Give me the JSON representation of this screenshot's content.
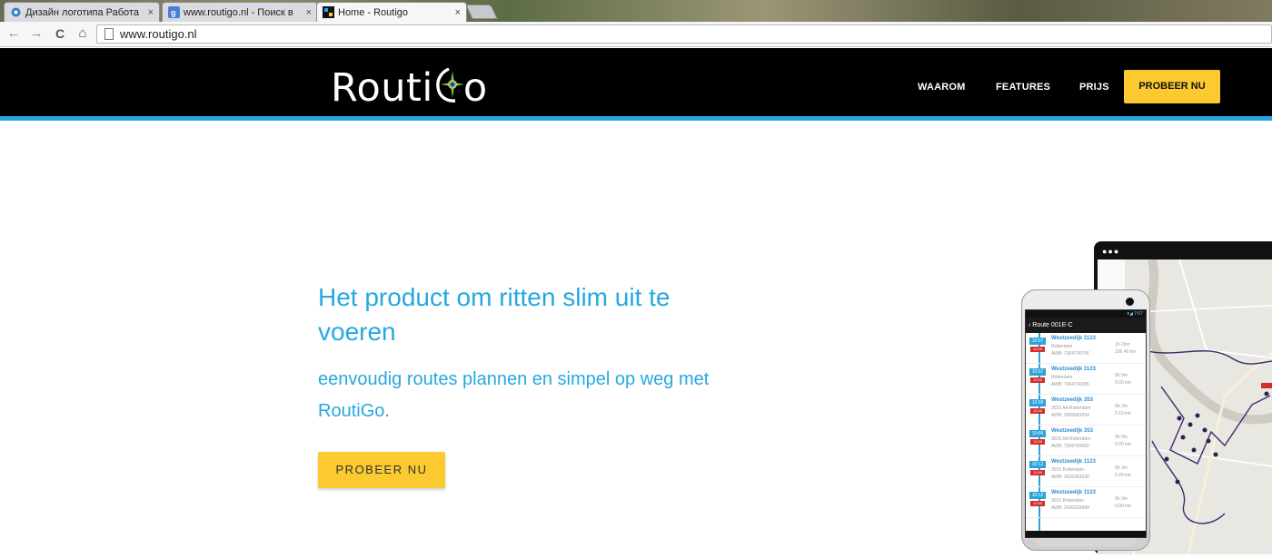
{
  "browser": {
    "tabs": [
      {
        "title": "Дизайн логотипа Работа",
        "active": false,
        "favicon": "gear-icon"
      },
      {
        "title": "www.routigo.nl - Поиск в",
        "active": false,
        "favicon": "google-icon"
      },
      {
        "title": "Home - Routigo",
        "active": true,
        "favicon": "routigo-icon"
      }
    ],
    "close_glyph": "×",
    "nav": {
      "back": "←",
      "forward": "→",
      "reload": "C",
      "home": "⌂"
    },
    "address": "www.routigo.nl"
  },
  "header": {
    "logo_left": "Routi",
    "logo_right": "o",
    "menu": [
      "WAAROM",
      "FEATURES",
      "PRIJS"
    ],
    "cta": "PROBEER NU"
  },
  "hero": {
    "title": "Het product om ritten slim uit te voeren",
    "subtitle": "eenvoudig routes plannen en simpel op weg met RoutiGo.",
    "cta": "PROBEER NU"
  },
  "phone_app": {
    "status": "▾◢ 7:07",
    "title": "‹ Route 001E-C",
    "stops": [
      {
        "time": "10:07",
        "tag": "12:00",
        "street": "Westzeedijk 1123",
        "city": "Rotterdam",
        "awb": "AWB: 7364730796",
        "dur": "1h 20m",
        "dist": "106.40 km"
      },
      {
        "time": "10:07",
        "tag": "12:00",
        "street": "Westzeedijk 1123",
        "city": "Rotterdam",
        "awb": "AWB: 7364730395",
        "dur": "0h 0m",
        "dist": "0.00 km"
      },
      {
        "time": "10:09",
        "tag": "12:00",
        "street": "Westzeedijk 353",
        "city": "3015 AA Rotterdam",
        "awb": "AWB: 2006583654",
        "dur": "0h 2m",
        "dist": "0.10 km"
      },
      {
        "time": "10:09",
        "tag": "12:00",
        "street": "Westzeedijk 353",
        "city": "3015 AA Rotterdam",
        "awb": "AWB: 7268760602",
        "dur": "0h 0m",
        "dist": "0.00 km"
      },
      {
        "time": "10:12",
        "tag": "12:00",
        "street": "Westzeedijk 1123",
        "city": "3015 Rotterdam",
        "awb": "AWB: 2620343530",
        "dur": "0h 3m",
        "dist": "0.20 km"
      },
      {
        "time": "10:12",
        "tag": "12:00",
        "street": "Westzeedijk 1123",
        "city": "3015 Rotterdam",
        "awb": "AWB: 2630303694",
        "dur": "0h 0m",
        "dist": "0.00 km"
      }
    ]
  },
  "colors": {
    "accent": "#25a7e0",
    "cta": "#fbc930",
    "header_bg": "#000000"
  }
}
